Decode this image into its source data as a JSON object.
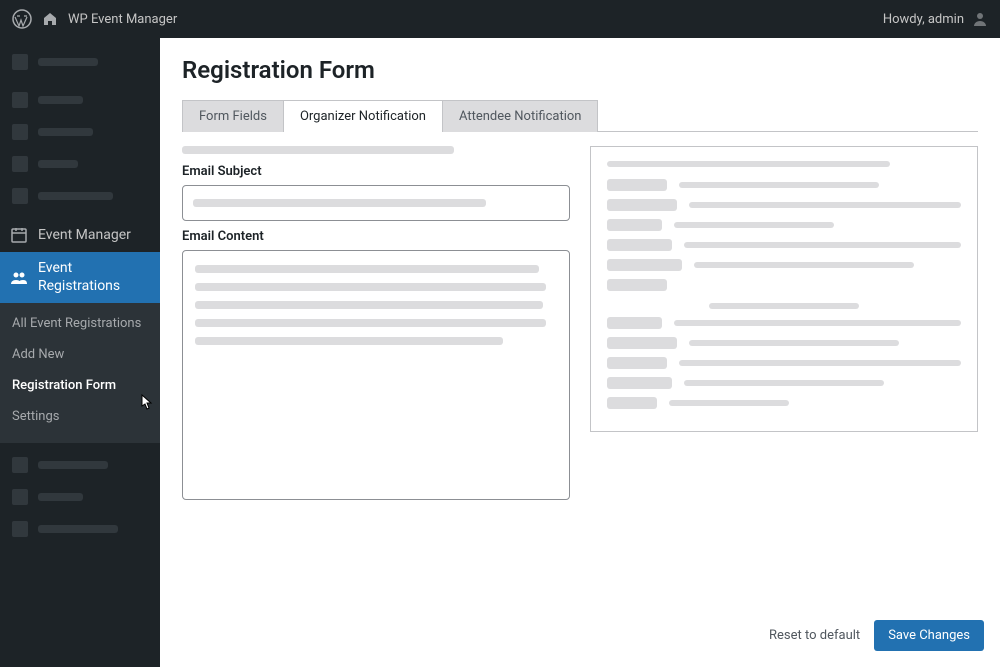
{
  "topbar": {
    "site_name": "WP Event Manager",
    "greeting": "Howdy, admin"
  },
  "sidebar": {
    "event_manager_label": "Event Manager",
    "event_registrations_label": "Event Registrations",
    "submenu": {
      "all": "All Event Registrations",
      "add_new": "Add New",
      "registration_form": "Registration Form",
      "settings": "Settings"
    }
  },
  "page": {
    "title": "Registration Form",
    "tabs": {
      "form_fields": "Form Fields",
      "organizer_notification": "Organizer Notification",
      "attendee_notification": "Attendee Notification"
    },
    "labels": {
      "email_subject": "Email Subject",
      "email_content": "Email Content"
    }
  },
  "footer": {
    "reset": "Reset to default",
    "save": "Save Changes"
  }
}
